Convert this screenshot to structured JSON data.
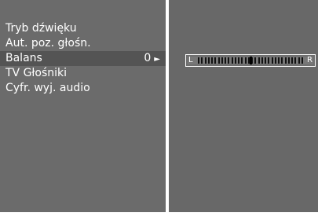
{
  "menu": {
    "items": [
      {
        "label": "Tryb dźwięku"
      },
      {
        "label": "Aut. poz. głośn."
      },
      {
        "label": "Balans",
        "value": "0",
        "selected": true
      },
      {
        "label": "TV Głośniki"
      },
      {
        "label": "Cyfr. wyj. audio"
      }
    ]
  },
  "balance": {
    "left_label": "L",
    "right_label": "R",
    "value": 0,
    "min": -50,
    "max": 50
  }
}
